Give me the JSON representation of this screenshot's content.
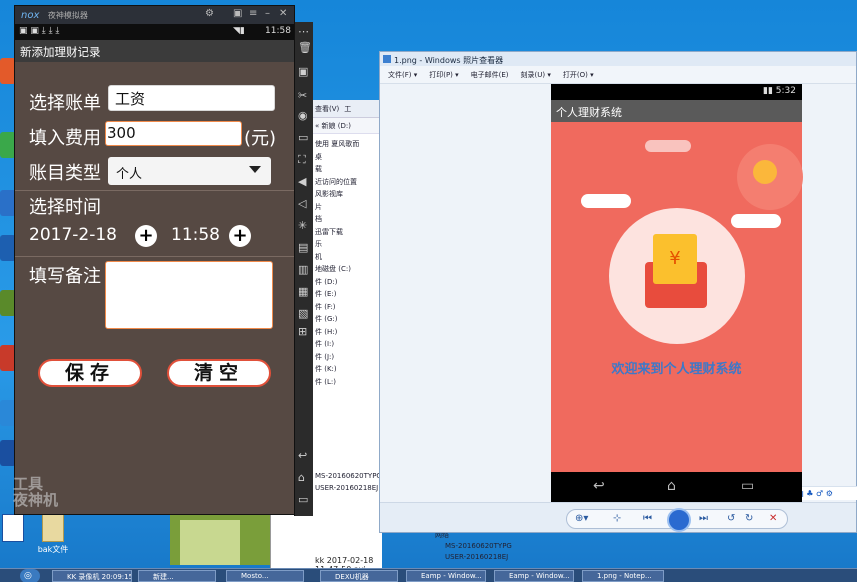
{
  "emulator": {
    "title": "夜神模拟器",
    "logo": "nox",
    "status_time": "11:58",
    "app_title": "新添加理财记录",
    "form": {
      "account_label": "选择账单",
      "account_value": "工资",
      "amount_label": "填入费用",
      "amount_value": "300",
      "amount_unit": "(元)",
      "type_label": "账目类型",
      "type_value": "个人",
      "time_label": "选择时间",
      "date_value": "2017-2-18",
      "time_value": "11:58",
      "note_label": "填写备注",
      "note_value": "",
      "save_label": "保存",
      "clear_label": "清空"
    },
    "watermark": "工具\n夜神机"
  },
  "viewer": {
    "title": "1.png - Windows 照片查看器",
    "menu": [
      "文件(F) ▾",
      "打印(P) ▾",
      "电子邮件(E)",
      "刻录(U) ▾",
      "打开(O) ▾"
    ],
    "phone": {
      "status_time": "5:32",
      "app_title": "个人理财系统",
      "welcome": "欢迎来到个人理财系统",
      "card_symbol": "¥"
    },
    "ime": "中 ᴶ ·, ▦ ♣ ♂ ⚙"
  },
  "explorer": {
    "toolbar": [
      "查看(V)",
      "工"
    ],
    "address": "« 新娘 (D:)",
    "nav_item": "使用 夏风歌而",
    "items": [
      "桌",
      "载",
      "近访问的位置",
      "",
      "风影视库",
      "片",
      "档",
      "迅雷下载",
      "乐",
      "",
      "机",
      "地磁盘 (C:)",
      "件 (D:)",
      "件 (E:)",
      "件 (F:)",
      "件 (G:)",
      "件 (H:)",
      "件 (I:)",
      "件 (J:)",
      "件 (K:)",
      "件 (L:)"
    ],
    "bottom_items": [
      "MS-20160620TYPG",
      "USER-20160218EJ"
    ],
    "file_row": "kk 2017-02-18 11-47-50.avi",
    "network_label": "网络",
    "network_items": [
      "MS-20160620TYPG",
      "USER-20160218EJ"
    ]
  },
  "desktop": {
    "files": [
      "",
      "bak文件"
    ]
  },
  "taskbar": {
    "items": [
      "KK 录像机 20:09:15",
      "新建...",
      "Mosto...",
      "DEXU机器",
      "Eamp - Window...",
      "Eamp - Window...",
      "1.png - Notep..."
    ]
  },
  "colors": {
    "form_bg": "#564943",
    "accent_orange": "#e0503a",
    "splash_red": "#f06a5e",
    "welcome_blue": "#3d78c8"
  }
}
